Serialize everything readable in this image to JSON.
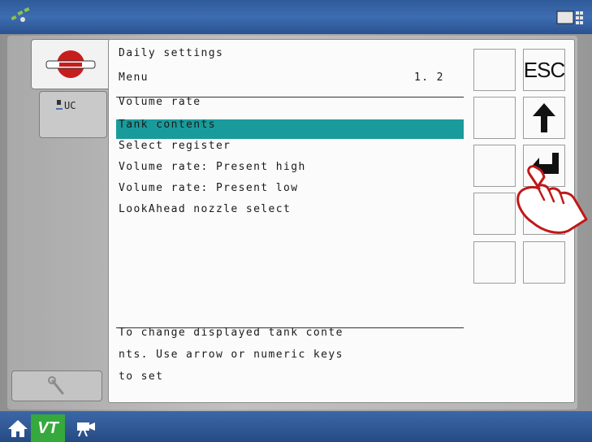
{
  "screen": {
    "title": "Daily settings",
    "subtitle": "Menu",
    "page_indicator": "1. 2"
  },
  "menu_items": [
    {
      "label": "Volume rate"
    },
    {
      "label": "Tank contents"
    },
    {
      "label": "Select register"
    },
    {
      "label": "Volume rate: Present high"
    },
    {
      "label": "Volume rate: Present low"
    },
    {
      "label": "LookAhead nozzle select"
    }
  ],
  "help_text": [
    "To change displayed tank conte",
    "nts. Use arrow or numeric keys",
    "to set"
  ],
  "tabs": {
    "uc_label": "UC"
  },
  "softkeys": {
    "esc_label": "ESC"
  },
  "bottom": {
    "vt_label": "VT"
  },
  "colors": {
    "highlight": "#1a9b9b",
    "top_bar": "#3d6cb0",
    "vt_button": "#35a93c"
  }
}
